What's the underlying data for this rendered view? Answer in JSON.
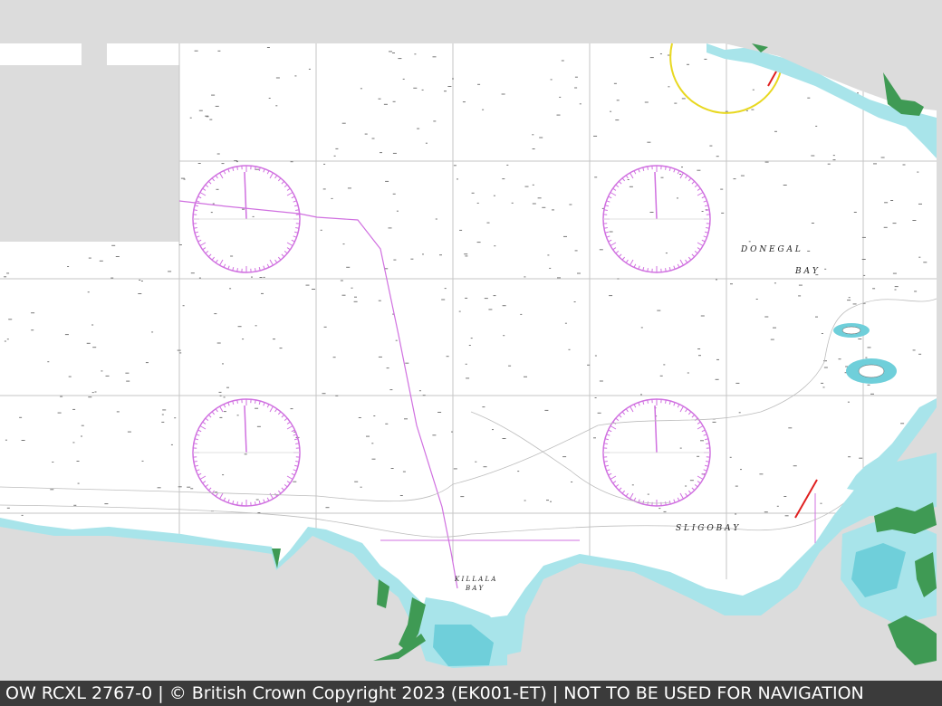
{
  "footer": {
    "text": "OW RCXL 2767-0 | © British Crown Copyright 2023 (EK001-ET) | NOT TO BE USED FOR NAVIGATION"
  },
  "chart": {
    "labels": {
      "donegal_line1": "D O N E G A L",
      "donegal_line2": "B A Y",
      "sligo_bay": "S L I G O   B A Y",
      "killala_line1": "K I L L A L A",
      "killala_line2": "B A Y"
    },
    "colors": {
      "sea": "#ffffff",
      "outside": "#dcdcdc",
      "land": "#dcdcdc",
      "shallow": "#a8e4ea",
      "shallow_deep": "#6fcfda",
      "green_land": "#3f9a54",
      "grid": "#c6c6c6",
      "magenta": "#d070e0",
      "footer_bg": "#3b3b3b"
    }
  }
}
